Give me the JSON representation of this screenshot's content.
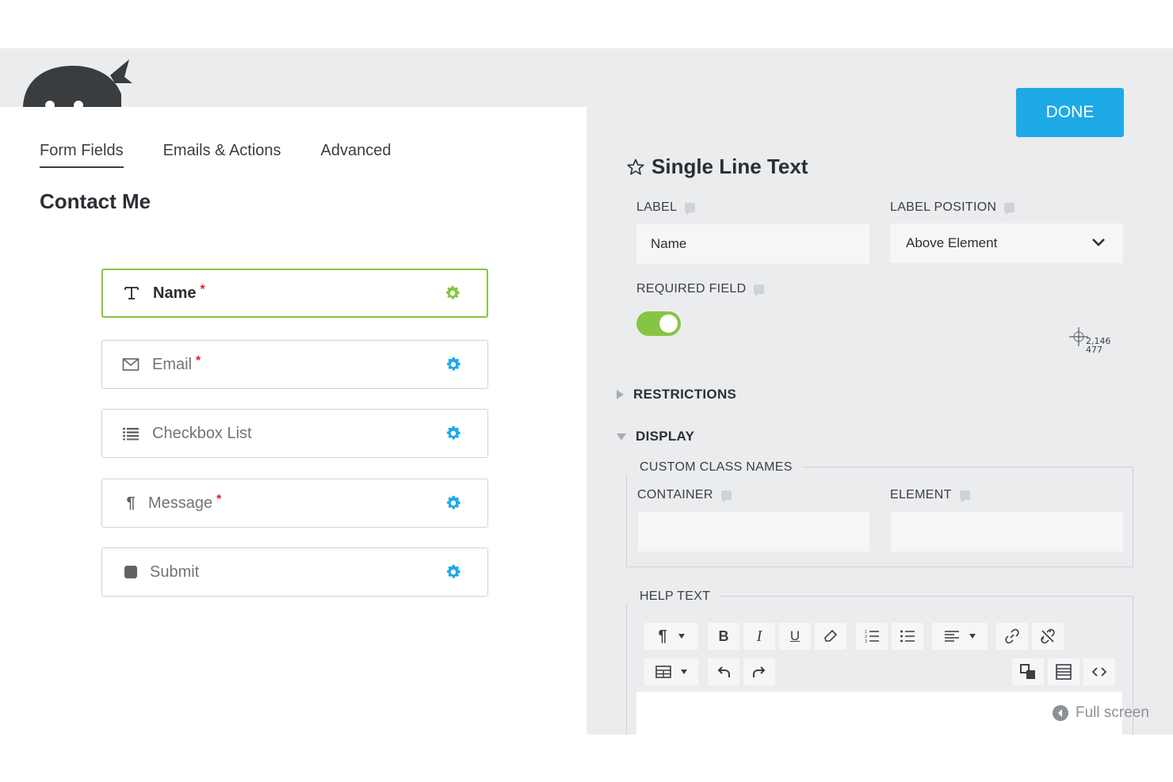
{
  "tabs": [
    {
      "label": "Form Fields",
      "active": true
    },
    {
      "label": "Emails & Actions",
      "active": false
    },
    {
      "label": "Advanced",
      "active": false
    }
  ],
  "form_title": "Contact Me",
  "fields": [
    {
      "label": "Name",
      "required": true,
      "icon": "text-cursor-icon",
      "active": true
    },
    {
      "label": "Email",
      "required": true,
      "icon": "envelope-icon",
      "active": false
    },
    {
      "label": "Checkbox List",
      "required": false,
      "icon": "list-icon",
      "active": false
    },
    {
      "label": "Message",
      "required": true,
      "icon": "paragraph-icon",
      "active": false
    },
    {
      "label": "Submit",
      "required": false,
      "icon": "square-icon",
      "active": false
    }
  ],
  "required_marker": "*",
  "done_label": "DONE",
  "settings": {
    "title": "Single Line Text",
    "label_heading": "LABEL",
    "label_value": "Name",
    "label_position_heading": "LABEL POSITION",
    "label_position_value": "Above Element",
    "required_heading": "REQUIRED FIELD",
    "required_on": true,
    "restrictions_heading": "RESTRICTIONS",
    "display_heading": "DISPLAY",
    "custom_class_heading": "CUSTOM CLASS NAMES",
    "container_heading": "CONTAINER",
    "element_heading": "ELEMENT",
    "help_text_heading": "HELP TEXT",
    "fullscreen_label": "Full screen"
  },
  "cursor_readout": {
    "line1": "2,146",
    "line2": "477"
  },
  "colors": {
    "accent_blue": "#1ea9e7",
    "accent_green": "#86c543",
    "required_red": "#e0201f"
  }
}
